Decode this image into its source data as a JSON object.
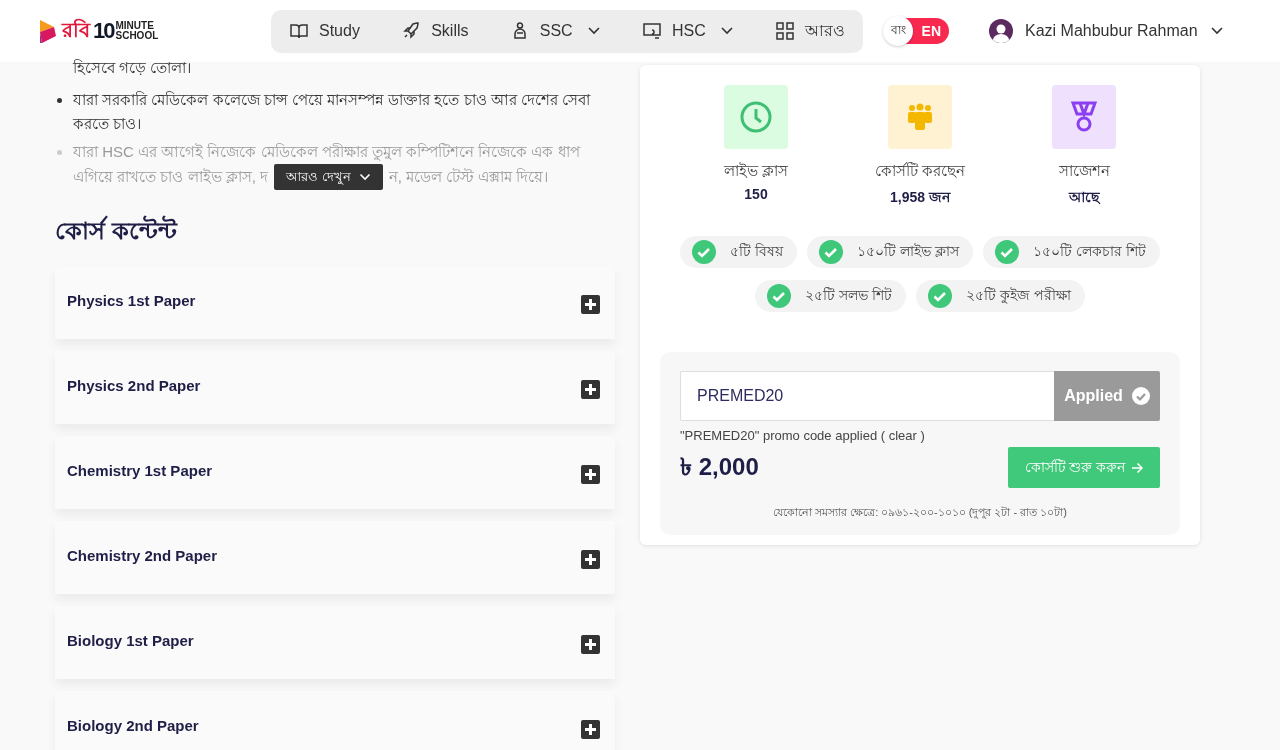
{
  "header": {
    "logo": {
      "brand": "রবি",
      "number": "10",
      "line_1": "MINUTE",
      "line_2": "SCHOOL"
    },
    "nav": [
      {
        "label": "Study",
        "dropdown": false
      },
      {
        "label": "Skills",
        "dropdown": false
      },
      {
        "label": "SSC",
        "dropdown": true
      },
      {
        "label": "HSC",
        "dropdown": true
      },
      {
        "label": "আরও",
        "dropdown": false
      }
    ],
    "language": [
      {
        "label": "বাং",
        "selected": false
      },
      {
        "label": "EN",
        "selected": true
      }
    ],
    "user": {
      "name": "Kazi Mahbubur Rahman"
    }
  },
  "description": {
    "continuation": "হিসেবে গড়ে তোলা।",
    "bullets": [
      "যারা সরকারি মেডিকেল কলেজে চান্স পেয়ে মানসম্পন্ন ডাক্তার হতে চাও আর দেশের সেবা করতে চাও।"
    ],
    "faded_bullet": {
      "line_1": "যারা HSC এর আগেই নিজেকে মেডিকেল পরীক্ষার তুমুল কম্পিটিশনে নিজেকে এক ধাপ",
      "line_2_start": "এগিয়ে রাখতে চাও লাইভ ক্লাস, দ",
      "line_2_end": "ন, মডেল টেস্ট এক্সাম দিয়ে।"
    },
    "more_button": "আরও দেখুন"
  },
  "course_content": {
    "title": "কোর্স কন্টেন্ট",
    "sections": [
      {
        "title": "Physics 1st Paper",
        "expanded": false
      },
      {
        "title": "Physics 2nd Paper",
        "expanded": false
      },
      {
        "title": "Chemistry 1st Paper",
        "expanded": false
      },
      {
        "title": "Chemistry 2nd Paper",
        "expanded": false
      },
      {
        "title": "Biology 1st Paper",
        "expanded": false
      },
      {
        "title": "Biology 2nd Paper",
        "expanded": false
      }
    ]
  },
  "course_card": {
    "stats": [
      {
        "kind": "clock",
        "label": "লাইভ ক্লাস",
        "value": "150"
      },
      {
        "kind": "people",
        "label": "কোর্সটি করছেন",
        "value": "1,958 জন"
      },
      {
        "kind": "medal",
        "label": "সাজেশন",
        "value": "আছে"
      }
    ],
    "features": [
      "৫টি বিষয়",
      "১৫০টি লাইভ ক্লাস",
      "১৫০টি লেকচার শিট",
      "২৫টি সলভ শিট",
      "২৫টি কুইজ পরীক্ষা"
    ],
    "promo": {
      "value": "PREMED20",
      "button": "Applied",
      "applied": true,
      "message_start": "\"PREMED20\" promo code applied (",
      "clear_link": "clear",
      "message_end": ")"
    },
    "price": "৳ 2,000",
    "cta": "কোর্সটি শুরু করুন",
    "helpline": "যেকোনো সমস্যার ক্ষেত্রে: ০৯৬১-২০০-১০১০ (দুপুর ২টা - রাত ১০টা)"
  }
}
